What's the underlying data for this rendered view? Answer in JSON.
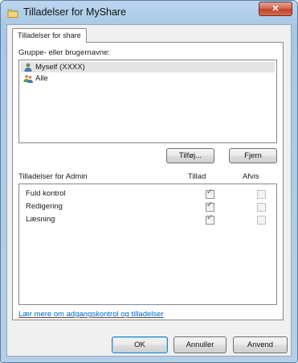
{
  "window": {
    "title": "Tilladelser for MyShare",
    "close_label": "✕"
  },
  "tab": {
    "label": "Tilladelser for share"
  },
  "users": {
    "heading": "Gruppe- eller brugernavne:",
    "items": [
      {
        "label": "Myself (XXXX)",
        "selected": true
      },
      {
        "label": "Alle",
        "selected": false
      }
    ],
    "add_label": "Tilføj...",
    "remove_label": "Fjern"
  },
  "permissions": {
    "heading": "Tilladelser for Admin",
    "col_allow": "Tillad",
    "col_deny": "Afvis",
    "rows": [
      {
        "label": "Fuld kontrol",
        "allow": true,
        "deny": false
      },
      {
        "label": "Redigering",
        "allow": true,
        "deny": false
      },
      {
        "label": "Læsning",
        "allow": true,
        "deny": false
      }
    ]
  },
  "help_link": "Lær mere om adgangskontrol og tilladelser",
  "footer": {
    "ok": "OK",
    "cancel": "Annuller",
    "apply": "Anvend"
  },
  "colors": {
    "link": "#0066cc",
    "titlebar": "#a9c8e6",
    "close": "#c0432c"
  }
}
